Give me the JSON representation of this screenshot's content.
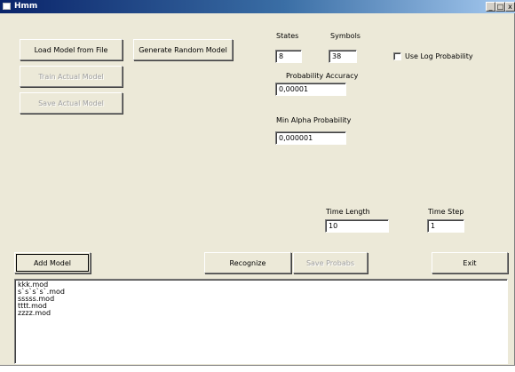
{
  "window": {
    "title": "Hmm",
    "minimize": "_",
    "maximize": "□",
    "close": "x"
  },
  "buttons": {
    "load_model": "Load Model from File",
    "generate_random": "Generate Random Model",
    "train_actual": "Train Actual Model",
    "save_actual": "Save Actual Model",
    "add_model": "Add Model",
    "recognize": "Recognize",
    "save_probabs": "Save Probabs",
    "exit": "Exit"
  },
  "fields": {
    "states": {
      "label": "States",
      "value": "8"
    },
    "symbols": {
      "label": "Symbols",
      "value": "38"
    },
    "probability_accuracy": {
      "label": "Probability Accuracy",
      "value": "0,00001"
    },
    "min_alpha_probability": {
      "label": "Min Alpha Probability",
      "value": "0,000001"
    },
    "time_length": {
      "label": "Time Length",
      "value": "10"
    },
    "time_step": {
      "label": "Time Step",
      "value": "1"
    }
  },
  "use_log_probability": {
    "label": "Use Log Probability",
    "checked": false
  },
  "model_list": [
    "kkk.mod",
    "s`s`s`s`.mod",
    "sssss.mod",
    "tttt.mod",
    "zzzz.mod"
  ]
}
